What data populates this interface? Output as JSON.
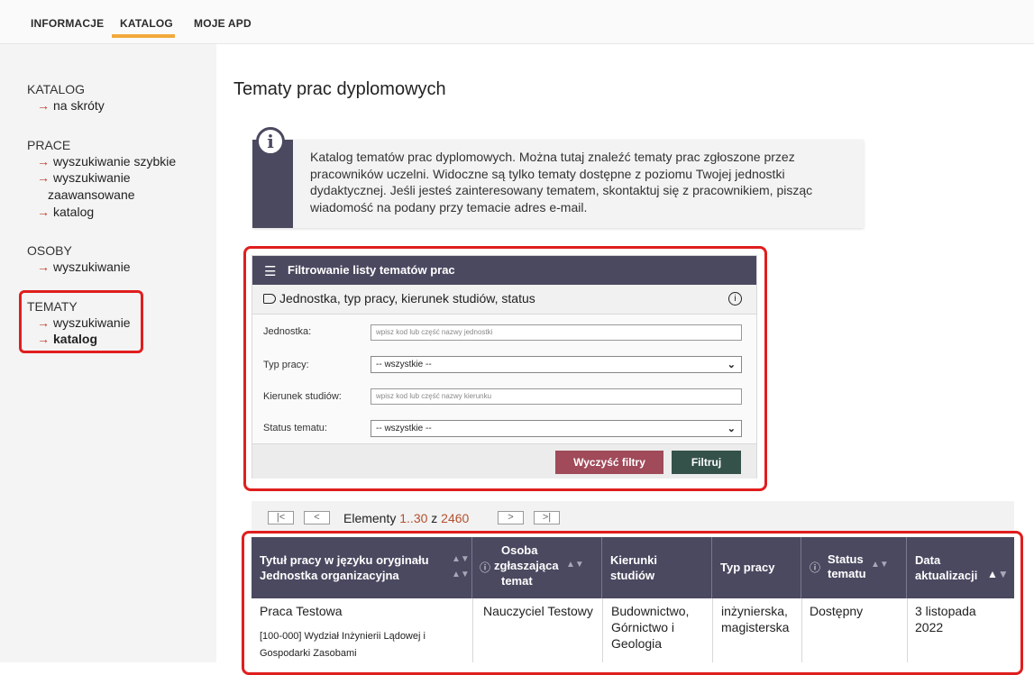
{
  "topnav": {
    "items": [
      "INFORMACJE",
      "KATALOG",
      "MOJE APD"
    ]
  },
  "sidebar": {
    "sections": [
      {
        "head": "KATALOG",
        "links": [
          "na skróty"
        ]
      },
      {
        "head": "PRACE",
        "links": [
          "wyszukiwanie szybkie",
          "wyszukiwanie",
          "zaawansowane",
          "katalog"
        ]
      },
      {
        "head": "OSOBY",
        "links": [
          "wyszukiwanie"
        ]
      },
      {
        "head": "TEMATY",
        "links": [
          "wyszukiwanie",
          "katalog"
        ]
      }
    ],
    "arrow": "→"
  },
  "page": {
    "title": "Tematy prac dyplomowych"
  },
  "info": {
    "lines": [
      "Katalog tematów prac dyplomowych. Można tutaj znaleźć tematy prac zgłoszone przez",
      "pracowników uczelni. Widoczne są tylko tematy dostępne z poziomu Twojej jednostki",
      "dydaktycznej. Jeśli jesteś zainteresowany tematem, skontaktuj się z pracownikiem, pisząc",
      "wiadomość na podany przy temacie adres e-mail."
    ]
  },
  "filter": {
    "header": "Filtrowanie listy tematów prac",
    "sub": "Jednostka, typ pracy, kierunek studiów, status",
    "fields": [
      {
        "label": "Jednostka:",
        "placeholder": "wpisz kod lub część nazwy jednostki"
      },
      {
        "label": "Typ pracy:",
        "value": "-- wszystkie --"
      },
      {
        "label": "Kierunek studiów:",
        "placeholder": "wpisz kod lub część nazwy kierunku"
      },
      {
        "label": "Status tematu:",
        "value": "-- wszystkie --"
      }
    ],
    "clear_label": "Wyczyść filtry",
    "submit_label": "Filtruj"
  },
  "pager": {
    "first": "|<",
    "prev": "<",
    "next": ">",
    "last": ">|",
    "label": "Elementy",
    "range": "1..30",
    "of": "z",
    "total": "2460"
  },
  "table": {
    "headers": {
      "title_1": "Tytuł pracy w języku oryginału",
      "title_2": "Jednostka organizacyjna",
      "person_1": "Osoba",
      "person_2": "zgłaszająca",
      "person_3": "temat",
      "fields_1": "Kierunki",
      "fields_2": "studiów",
      "type": "Typ pracy",
      "status_1": "Status",
      "status_2": "tematu",
      "date_1": "Data",
      "date_2": "aktualizacji"
    },
    "row": {
      "title": "Praca Testowa",
      "unit_1": "[100-000] Wydział Inżynierii Lądowej i",
      "unit_2": "Gospodarki Zasobami",
      "person": "Nauczyciel Testowy",
      "fields_1": "Budownictwo,",
      "fields_2": "Górnictwo i",
      "fields_3": "Geologia",
      "type_1": "inżynierska,",
      "type_2": "magisterska",
      "status": "Dostępny",
      "date_1": "3 listopada",
      "date_2": "2022"
    }
  }
}
